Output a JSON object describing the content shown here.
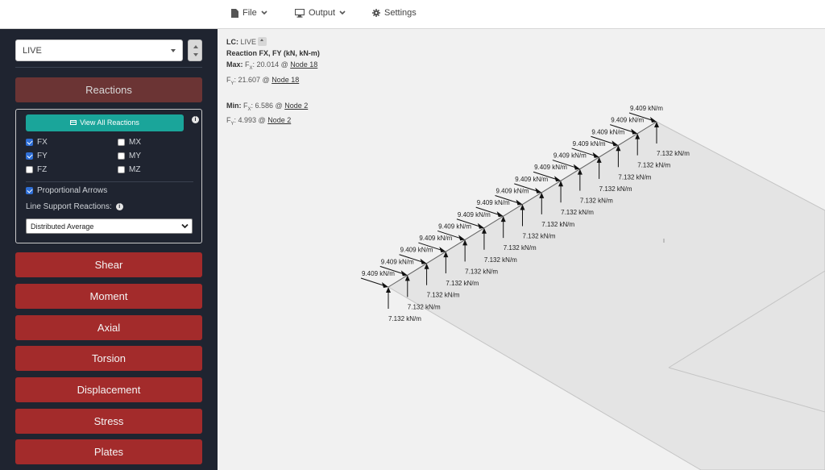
{
  "menu": {
    "file": "File",
    "output": "Output",
    "settings": "Settings"
  },
  "sidebar": {
    "load_case": "LIVE",
    "reactions": "Reactions",
    "view_all": "View All Reactions",
    "checks": {
      "fx": {
        "label": "FX",
        "checked": true
      },
      "fy": {
        "label": "FY",
        "checked": true
      },
      "fz": {
        "label": "FZ",
        "checked": false
      },
      "mx": {
        "label": "MX",
        "checked": false
      },
      "my": {
        "label": "MY",
        "checked": false
      },
      "mz": {
        "label": "MZ",
        "checked": false
      }
    },
    "proportional": {
      "label": "Proportional Arrows",
      "checked": true
    },
    "line_support_label": "Line Support Reactions:",
    "line_support_value": "Distributed Average",
    "buttons": {
      "shear": "Shear",
      "moment": "Moment",
      "axial": "Axial",
      "torsion": "Torsion",
      "displacement": "Displacement",
      "stress": "Stress",
      "plates": "Plates"
    }
  },
  "info": {
    "lc_label": "LC:",
    "lc_value": "LIVE",
    "reaction_title": "Reaction FX, FY (kN, kN-m)",
    "max_label": "Max:",
    "max_fx_prefix": "F",
    "max_fx_sub": "X",
    "max_fx_value": ": 20.014 @ ",
    "max_fx_node": "Node 18",
    "max_fy_prefix": "F",
    "max_fy_sub": "Y",
    "max_fy_value": ": 21.607 @ ",
    "max_fy_node": "Node 18",
    "min_label": "Min:",
    "min_fx_prefix": "F",
    "min_fx_sub": "X",
    "min_fx_value": ": 6.586 @ ",
    "min_fx_node": "Node 2",
    "min_fy_prefix": "F",
    "min_fy_sub": "Y",
    "min_fy_value": ": 4.993 @ ",
    "min_fy_node": "Node 2"
  },
  "reactions_labels": {
    "horizontal": "9.409 kN/m",
    "vertical": "7.132 kN/m",
    "count": 15
  },
  "colors": {
    "sidebar_bg": "#1f2430",
    "button_red": "#a32b2b",
    "button_active": "#6b3434",
    "teal": "#1aa59a"
  }
}
